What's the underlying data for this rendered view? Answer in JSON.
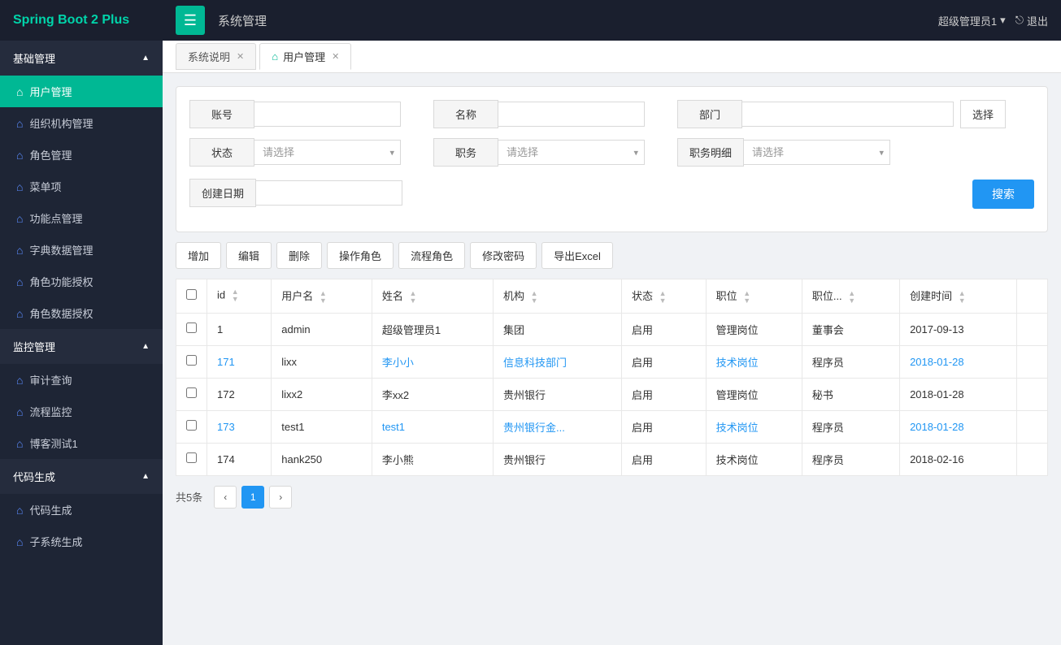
{
  "navbar": {
    "brand": "Spring Boot 2 Plus",
    "menu_btn": "☰",
    "title": "系统管理",
    "user": "超级管理员1",
    "logout": "退出"
  },
  "sidebar": {
    "sections": [
      {
        "label": "基础管理",
        "expanded": true,
        "items": [
          {
            "label": "用户管理",
            "active": true
          },
          {
            "label": "组织机构管理",
            "active": false
          },
          {
            "label": "角色管理",
            "active": false
          },
          {
            "label": "菜单项",
            "active": false
          },
          {
            "label": "功能点管理",
            "active": false
          },
          {
            "label": "字典数据管理",
            "active": false
          },
          {
            "label": "角色功能授权",
            "active": false
          },
          {
            "label": "角色数据授权",
            "active": false
          }
        ]
      },
      {
        "label": "监控管理",
        "expanded": true,
        "items": [
          {
            "label": "审计查询",
            "active": false
          },
          {
            "label": "流程监控",
            "active": false
          },
          {
            "label": "博客测试1",
            "active": false
          }
        ]
      },
      {
        "label": "代码生成",
        "expanded": true,
        "items": [
          {
            "label": "代码生成",
            "active": false
          },
          {
            "label": "子系统生成",
            "active": false
          }
        ]
      }
    ]
  },
  "tabs": [
    {
      "label": "系统说明",
      "closable": true,
      "icon": false,
      "active": false
    },
    {
      "label": "用户管理",
      "closable": true,
      "icon": true,
      "active": true
    }
  ],
  "search_form": {
    "account_label": "账号",
    "account_placeholder": "",
    "name_label": "名称",
    "name_placeholder": "",
    "dept_label": "部门",
    "dept_placeholder": "",
    "choose_btn": "选择",
    "status_label": "状态",
    "status_placeholder": "请选择",
    "job_label": "职务",
    "job_placeholder": "请选择",
    "job_detail_label": "职务明细",
    "job_detail_placeholder": "请选择",
    "date_label": "创建日期",
    "date_placeholder": "",
    "search_btn": "搜索"
  },
  "action_buttons": [
    {
      "label": "增加"
    },
    {
      "label": "编辑"
    },
    {
      "label": "删除"
    },
    {
      "label": "操作角色"
    },
    {
      "label": "流程角色"
    },
    {
      "label": "修改密码"
    },
    {
      "label": "导出Excel"
    }
  ],
  "table": {
    "columns": [
      {
        "key": "checkbox",
        "label": ""
      },
      {
        "key": "id",
        "label": "id",
        "sortable": true
      },
      {
        "key": "username",
        "label": "用户名",
        "sortable": true
      },
      {
        "key": "realname",
        "label": "姓名",
        "sortable": true
      },
      {
        "key": "org",
        "label": "机构",
        "sortable": true
      },
      {
        "key": "status",
        "label": "状态",
        "sortable": true
      },
      {
        "key": "position",
        "label": "职位",
        "sortable": true
      },
      {
        "key": "position_detail",
        "label": "职位...",
        "sortable": true
      },
      {
        "key": "created_at",
        "label": "创建时间",
        "sortable": true
      },
      {
        "key": "actions",
        "label": ""
      }
    ],
    "rows": [
      {
        "id": "1",
        "username": "admin",
        "realname": "超级管理员1",
        "org": "集团",
        "status": "启用",
        "position": "管理岗位",
        "position_detail": "董事会",
        "created_at": "2017-09-13",
        "id_link": false,
        "realname_link": true,
        "org_link": false,
        "position_link": false
      },
      {
        "id": "171",
        "username": "lixx",
        "realname": "李小小",
        "org": "信息科技部门",
        "status": "启用",
        "position": "技术岗位",
        "position_detail": "程序员",
        "created_at": "2018-01-28",
        "id_link": true,
        "realname_link": true,
        "org_link": true,
        "position_link": true
      },
      {
        "id": "172",
        "username": "lixx2",
        "realname": "李xx2",
        "org": "贵州银行",
        "status": "启用",
        "position": "管理岗位",
        "position_detail": "秘书",
        "created_at": "2018-01-28",
        "id_link": false,
        "realname_link": false,
        "org_link": false,
        "position_link": false
      },
      {
        "id": "173",
        "username": "test1",
        "realname": "test1",
        "org": "贵州银行金...",
        "status": "启用",
        "position": "技术岗位",
        "position_detail": "程序员",
        "created_at": "2018-01-28",
        "id_link": true,
        "realname_link": true,
        "org_link": true,
        "position_link": true
      },
      {
        "id": "174",
        "username": "hank250",
        "realname": "李小熊",
        "org": "贵州银行",
        "status": "启用",
        "position": "技术岗位",
        "position_detail": "程序员",
        "created_at": "2018-02-16",
        "id_link": false,
        "realname_link": false,
        "org_link": false,
        "position_link": false
      }
    ]
  },
  "pagination": {
    "total_text": "共5条",
    "current_page": 1,
    "prev": "‹",
    "next": "›"
  }
}
